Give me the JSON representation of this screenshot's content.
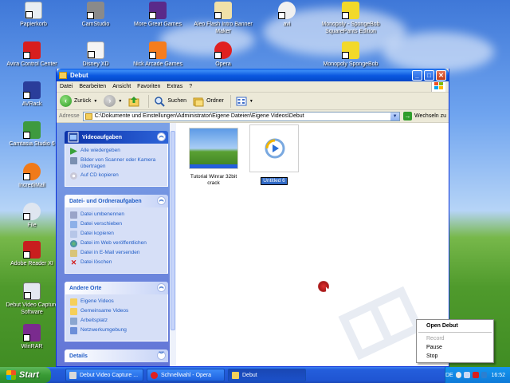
{
  "desktop": {
    "icons": [
      {
        "label": "Papierkorb"
      },
      {
        "label": "CamStudio"
      },
      {
        "label": "More Great Games"
      },
      {
        "label": "Aleo Flash Intro Banner Maker"
      },
      {
        "label": "avi"
      },
      {
        "label": "Monopoly - SpongeBob SquarePants Edition"
      },
      {
        "label": "Avira Control Center"
      },
      {
        "label": "Disney XD"
      },
      {
        "label": "Nick Arcade Games"
      },
      {
        "label": "Opera"
      },
      {
        "label": "Monopoly SpongeBob"
      },
      {
        "label": "AVRack"
      },
      {
        "label": "Camtasia Studio 6"
      },
      {
        "label": "IncrediMail"
      },
      {
        "label": "File"
      },
      {
        "label": "Adobe Reader XI"
      },
      {
        "label": "Debut Video Capture Software"
      },
      {
        "label": "WinRAR"
      }
    ]
  },
  "window": {
    "title": "Debut",
    "buttons": {
      "minimize": "_",
      "maximize": "□",
      "close": "✕"
    },
    "menu": [
      "Datei",
      "Bearbeiten",
      "Ansicht",
      "Favoriten",
      "Extras",
      "?"
    ],
    "toolbar": {
      "back": "Zurück",
      "search": "Suchen",
      "folders": "Ordner"
    },
    "address": {
      "label": "Adresse",
      "value": "C:\\Dokumente und Einstellungen\\Administrator\\Eigene Dateien\\Eigene Videos\\Debut",
      "go": "Wechseln zu"
    },
    "panels": [
      {
        "title": "Videoaufgaben",
        "items": [
          "Alle wiedergeben",
          "Bilder von Scanner oder Kamera übertragen",
          "Auf CD kopieren"
        ]
      },
      {
        "title": "Datei- und Ordneraufgaben",
        "items": [
          "Datei umbenennen",
          "Datei verschieben",
          "Datei kopieren",
          "Datei im Web veröffentlichen",
          "Datei in E-Mail versenden",
          "Datei löschen"
        ]
      },
      {
        "title": "Andere Orte",
        "items": [
          "Eigene Videos",
          "Gemeinsame Videos",
          "Arbeitsplatz",
          "Netzwerkumgebung"
        ]
      },
      {
        "title": "Details",
        "items": []
      }
    ],
    "files": [
      {
        "name": "Tutorial Winrar 32bit crack"
      },
      {
        "name": "Untitled 6"
      }
    ]
  },
  "context_menu": {
    "items": [
      {
        "label": "Open Debut",
        "style": "bold"
      },
      {
        "label": "Record",
        "style": "disabled"
      },
      {
        "label": "Pause",
        "style": "normal"
      },
      {
        "label": "Stop",
        "style": "normal"
      }
    ]
  },
  "taskbar": {
    "start": "Start",
    "tasks": [
      {
        "label": "Debut Video Capture ..."
      },
      {
        "label": "Schnellwahl - Opera"
      },
      {
        "label": "Debut"
      }
    ],
    "tray": {
      "lang": "DE",
      "time": "16:52"
    }
  },
  "colors": {
    "title_blue": "#0b58e0",
    "taskbar_blue": "#245edc",
    "start_green": "#399b35",
    "link_blue": "#215dc6"
  }
}
